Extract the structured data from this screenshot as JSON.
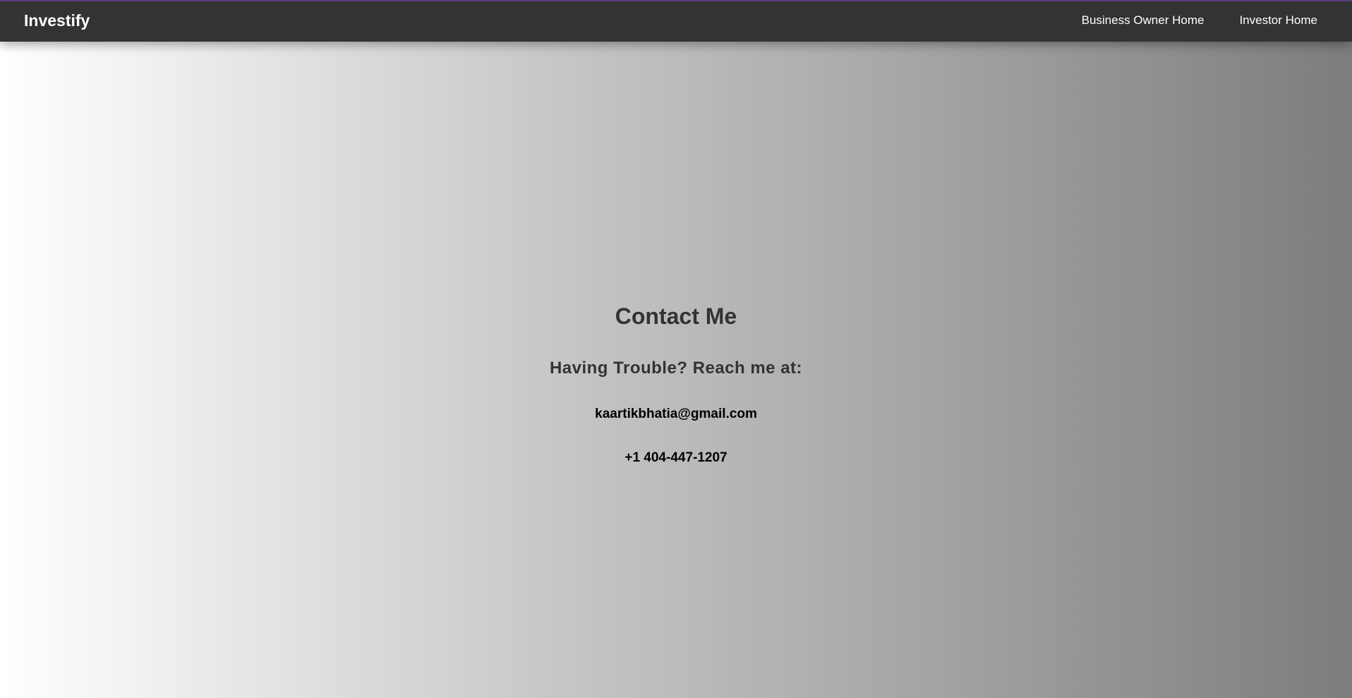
{
  "navbar": {
    "brand": "Investify",
    "links": [
      {
        "label": "Business Owner Home"
      },
      {
        "label": "Investor Home"
      }
    ]
  },
  "contact": {
    "title": "Contact Me",
    "subtitle": "Having Trouble? Reach me at:",
    "email": "kaartikbhatia@gmail.com",
    "phone": "+1 404-447-1207"
  },
  "colors": {
    "navbar_bg": "#333333",
    "navbar_accent": "#5b3a7a",
    "gradient_start": "#ffffff",
    "gradient_end": "#7d7d7d",
    "heading_text": "#333333"
  }
}
